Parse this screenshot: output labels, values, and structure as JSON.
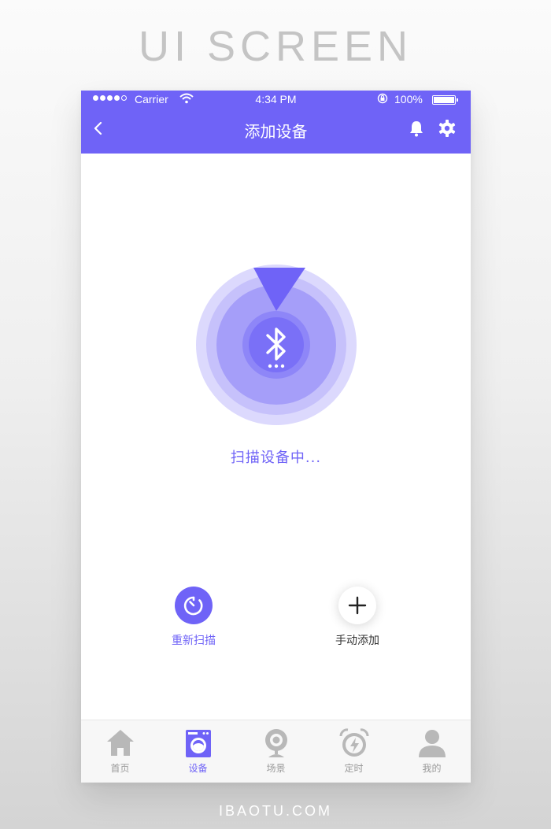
{
  "banner_text": "UI SCREEN",
  "footer_watermark": "IBAOTU.COM",
  "colors": {
    "accent": "#6f63f7",
    "inactive": "#b8b8b8",
    "background": "#ffffff"
  },
  "status_bar": {
    "carrier": "Carrier",
    "time": "4:34 PM",
    "battery": "100%"
  },
  "nav": {
    "title": "添加设备",
    "back_icon": "chevron-left-icon",
    "right_icons": [
      "bell-icon",
      "gear-icon"
    ]
  },
  "scan": {
    "status_text": "扫描设备中...",
    "icon": "bluetooth-icon"
  },
  "actions": [
    {
      "label": "重新扫描",
      "icon": "refresh-timer-icon"
    },
    {
      "label": "手动添加",
      "icon": "plus-icon"
    }
  ],
  "tabs": [
    {
      "label": "首页",
      "icon": "home-icon",
      "active": false
    },
    {
      "label": "设备",
      "icon": "washing-machine-icon",
      "active": true
    },
    {
      "label": "场景",
      "icon": "camera-icon",
      "active": false
    },
    {
      "label": "定时",
      "icon": "alarm-clock-icon",
      "active": false
    },
    {
      "label": "我的",
      "icon": "user-icon",
      "active": false
    }
  ]
}
